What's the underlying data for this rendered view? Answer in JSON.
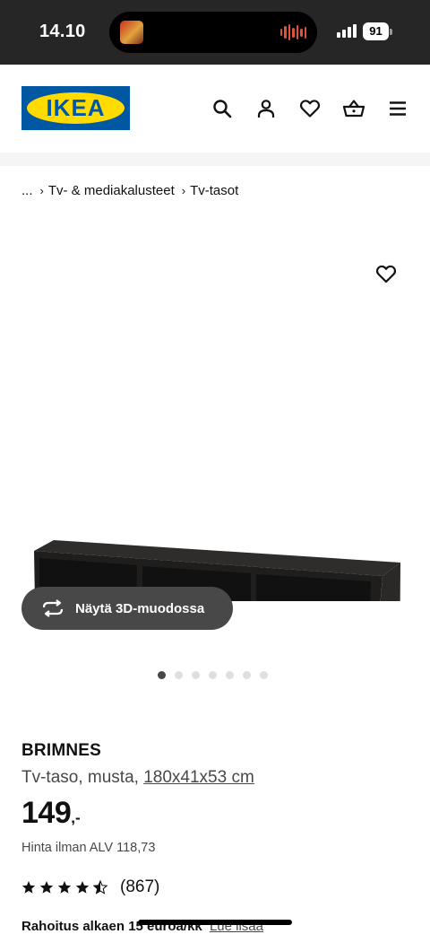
{
  "status_bar": {
    "time": "14.10",
    "battery": "91"
  },
  "header": {
    "logo_text": "IKEA",
    "brand_colors": {
      "blue": "#0058a3",
      "yellow": "#ffdb00"
    },
    "icons": [
      "search-icon",
      "user-icon",
      "heart-icon",
      "cart-icon",
      "menu-icon"
    ]
  },
  "breadcrumb": {
    "ellipsis": "...",
    "items": [
      "Tv- & mediakalusteet",
      "Tv-tasot"
    ]
  },
  "gallery": {
    "view_3d_label": "Näytä 3D-muodossa",
    "image_count": 7,
    "active_index": 0
  },
  "product": {
    "name": "BRIMNES",
    "description": "Tv-taso, musta,",
    "dimensions": "180x41x53 cm",
    "price_integer": "149",
    "price_decimal": ",-",
    "vat_text": "Hinta ilman ALV 118,73",
    "rating": 4.5,
    "review_count": "(867)",
    "finance_text": "Rahoitus alkaen 15 euroa/kk",
    "finance_link": "Lue lisää"
  }
}
